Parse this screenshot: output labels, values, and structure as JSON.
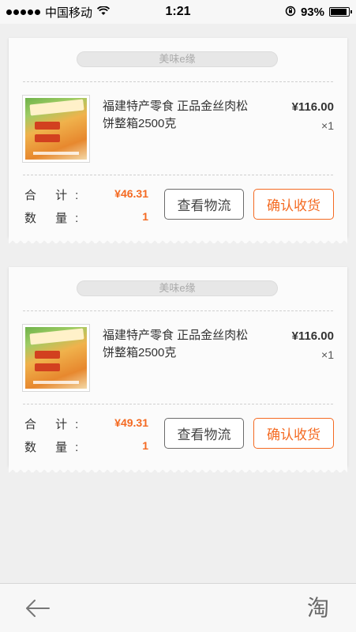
{
  "status_bar": {
    "carrier": "中国移动",
    "time": "1:21",
    "battery": "93%",
    "battery_level": 0.93
  },
  "orders": [
    {
      "shop_name": "美味e缘",
      "product_title": "福建特产零食 正品金丝肉松饼整箱2500克",
      "price": "¥116.00",
      "qty": "×1",
      "total_label": "合 计:",
      "total_value": "¥46.31",
      "count_label": "数 量:",
      "count_value": "1",
      "logistics_label": "查看物流",
      "confirm_label": "确认收货"
    },
    {
      "shop_name": "美味e缘",
      "product_title": "福建特产零食 正品金丝肉松饼整箱2500克",
      "price": "¥116.00",
      "qty": "×1",
      "total_label": "合 计:",
      "total_value": "¥49.31",
      "count_label": "数 量:",
      "count_value": "1",
      "logistics_label": "查看物流",
      "confirm_label": "确认收货"
    }
  ],
  "bottom_bar": {
    "back_icon": "back-arrow-icon",
    "taobao_icon": "淘"
  },
  "colors": {
    "accent": "#f46a22",
    "background": "#efefef"
  }
}
